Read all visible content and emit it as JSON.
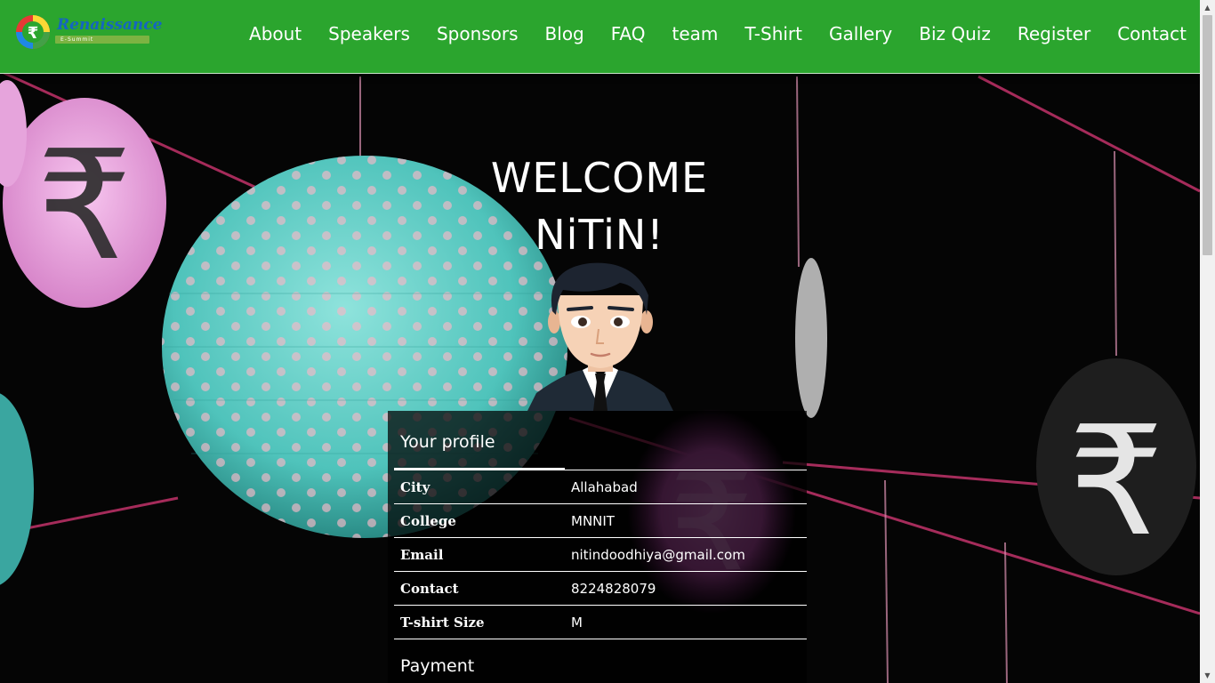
{
  "nav": {
    "brand": "Renaissance",
    "brand_tagline": "E-Summit",
    "links": [
      "About",
      "Speakers",
      "Sponsors",
      "Blog",
      "FAQ",
      "team",
      "T-Shirt",
      "Gallery",
      "Biz Quiz",
      "Register",
      "Contact"
    ]
  },
  "welcome": {
    "line1": "WELCOME",
    "line2": "NiTiN!"
  },
  "profile": {
    "title": "Your profile",
    "rows": [
      {
        "label": "City",
        "value": "Allahabad"
      },
      {
        "label": "College",
        "value": "MNNIT"
      },
      {
        "label": "Email",
        "value": "nitindoodhiya@gmail.com"
      },
      {
        "label": "Contact",
        "value": "8224828079"
      },
      {
        "label": "T-shirt Size",
        "value": "M"
      }
    ],
    "payment_heading": "Payment"
  },
  "colors": {
    "navbar": "#2ba52e",
    "background": "#000000",
    "text": "#ffffff"
  },
  "icons": {
    "logo": "renaissance-rupee-logo",
    "avatar": "user-avatar-man-in-suit"
  }
}
